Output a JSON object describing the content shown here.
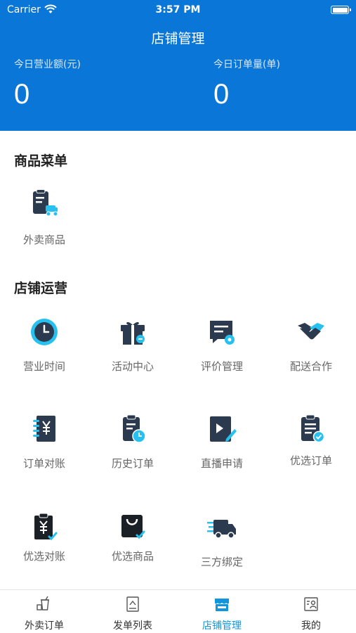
{
  "status_bar": {
    "carrier": "Carrier",
    "time": "3:57 PM"
  },
  "header": {
    "title": "店铺管理",
    "stats": [
      {
        "label": "今日营业额(元)",
        "value": "0"
      },
      {
        "label": "今日订单量(单)",
        "value": "0"
      }
    ]
  },
  "sections": {
    "menu": {
      "title": "商品菜单",
      "items": [
        {
          "label": "外卖商品",
          "icon": "takeout-goods-icon"
        }
      ]
    },
    "operations": {
      "title": "店铺运营",
      "items": [
        {
          "label": "营业时间",
          "icon": "clock-icon"
        },
        {
          "label": "活动中心",
          "icon": "gift-icon"
        },
        {
          "label": "评价管理",
          "icon": "review-icon"
        },
        {
          "label": "配送合作",
          "icon": "handshake-icon"
        },
        {
          "label": "订单对账",
          "icon": "yuan-notebook-icon"
        },
        {
          "label": "历史订单",
          "icon": "clipboard-clock-icon"
        },
        {
          "label": "直播申请",
          "icon": "video-edit-icon"
        },
        {
          "label": "优选订单",
          "icon": "clipboard-check-icon"
        },
        {
          "label": "优选对账",
          "icon": "yuan-clipboard-icon"
        },
        {
          "label": "优选商品",
          "icon": "shopping-bag-icon"
        },
        {
          "label": "三方绑定",
          "icon": "delivery-truck-icon"
        }
      ]
    }
  },
  "tabbar": {
    "items": [
      {
        "label": "外卖订单",
        "icon": "takeout-cup-icon"
      },
      {
        "label": "发单列表",
        "icon": "send-list-icon"
      },
      {
        "label": "店铺管理",
        "icon": "store-icon",
        "active": true
      },
      {
        "label": "我的",
        "icon": "profile-card-icon"
      }
    ]
  },
  "colors": {
    "brand": "#0A77D8",
    "icon_dark": "#2B3A4E",
    "icon_accent": "#27C1F0",
    "tab_active": "#1296DB"
  }
}
